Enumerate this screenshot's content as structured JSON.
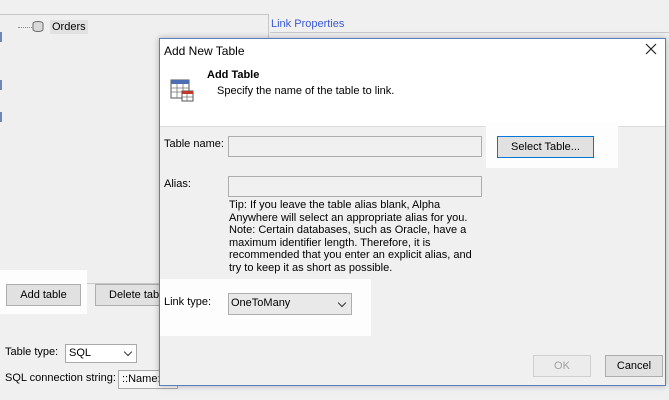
{
  "background": {
    "tree_item": "Orders",
    "link_properties": "Link Properties",
    "add_table_button": "Add table",
    "delete_table_button": "Delete table",
    "table_type_label": "Table type:",
    "table_type_value": "SQL",
    "sql_conn_label": "SQL connection string:",
    "sql_conn_value": "::Name::"
  },
  "dialog": {
    "title": "Add New Table",
    "header_title": "Add Table",
    "header_subtitle": "Specify the name of the table to link.",
    "table_name_label": "Table name:",
    "table_name_value": "",
    "select_table_button": "Select Table...",
    "alias_label": "Alias:",
    "alias_value": "",
    "tip_text": "Tip: If you leave the table alias blank, Alpha Anywhere will select an appropriate alias for you. Note: Certain databases, such as Oracle, have a maximum identifier length. Therefore, it is recommended that you enter an explicit alias, and try to keep it as short as possible.",
    "link_type_label": "Link type:",
    "link_type_value": "OneToMany",
    "ok_button": "OK",
    "cancel_button": "Cancel"
  },
  "icons": {
    "tree_item": "database-icon",
    "header": "table-link-icon",
    "close": "close-icon"
  },
  "colors": {
    "link_blue": "#3b5bd4",
    "dialog_border": "#5a7fbf"
  }
}
